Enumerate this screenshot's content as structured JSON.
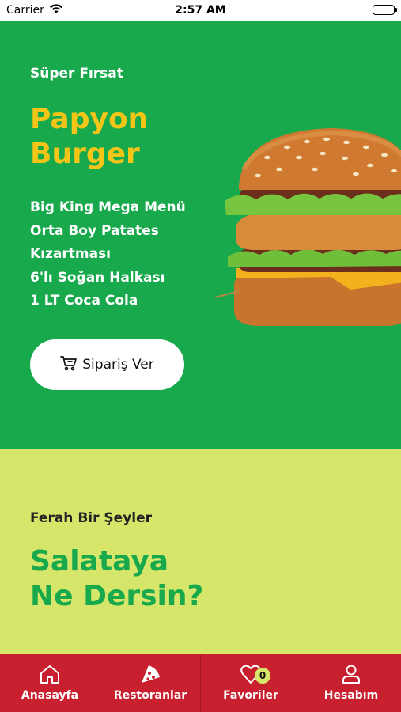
{
  "status": {
    "carrier": "Carrier",
    "time": "2:57 AM"
  },
  "promo": {
    "eyebrow": "Süper Fırsat",
    "title": "Papyon Burger",
    "items": [
      "Big King Mega Menü",
      "Orta Boy Patates",
      "Kızartması",
      "6'lı Soğan Halkası",
      "1 LT Coca Cola"
    ],
    "cta": {
      "label": "Sipariş Ver",
      "icon": "cart-icon"
    },
    "bg_color": "#17a94c",
    "title_color": "#f5c518"
  },
  "salad": {
    "eyebrow": "Ferah Bir Şeyler",
    "title": "Salataya Ne Dersin?",
    "bg_color": "#d6e66a"
  },
  "tabbar": {
    "bg_color": "#c8202f",
    "tabs": [
      {
        "label": "Anasayfa",
        "icon": "home-icon"
      },
      {
        "label": "Restoranlar",
        "icon": "pizza-icon"
      },
      {
        "label": "Favoriler",
        "icon": "heart-icon",
        "badge": "0"
      },
      {
        "label": "Hesabım",
        "icon": "user-icon"
      }
    ]
  }
}
